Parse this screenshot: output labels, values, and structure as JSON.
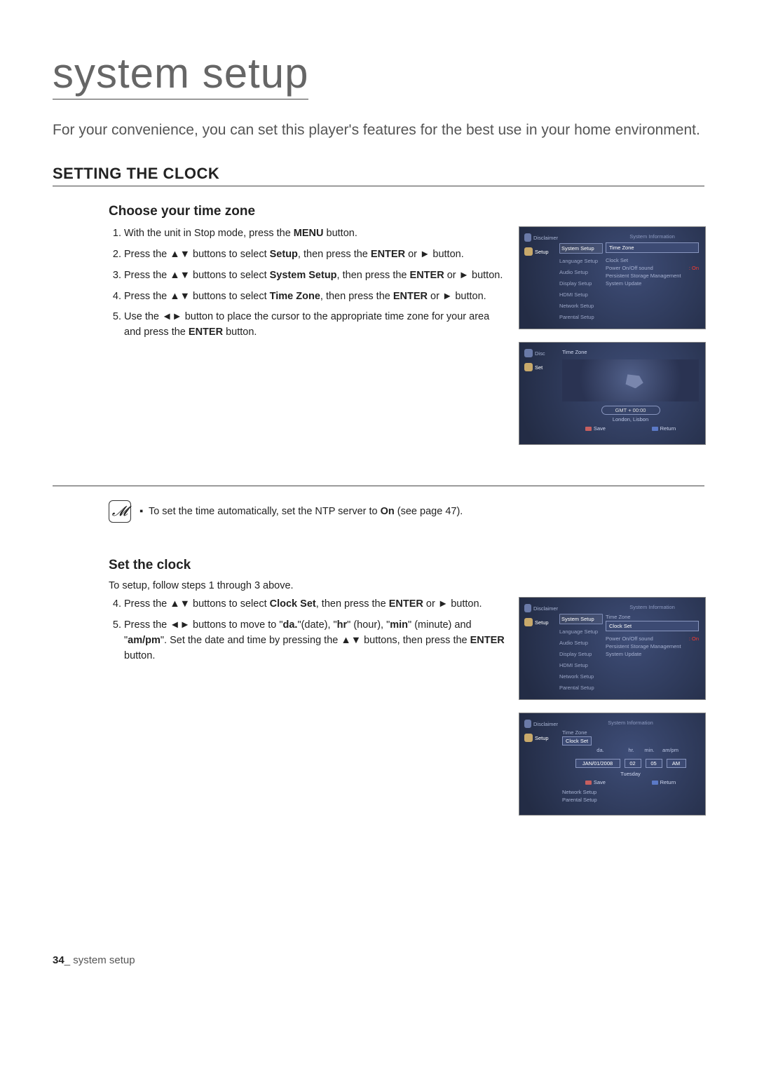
{
  "title": "system setup",
  "intro": "For your convenience, you can set this player's features for the best use in your home environment.",
  "section1_heading": "SETTING THE CLOCK",
  "sub1_heading": "Choose your time zone",
  "arrows_ud": "▲▼",
  "arrows_lr": "◄►",
  "arrow_r": "►",
  "steps1": {
    "s1_a": "With the unit in Stop mode, press the ",
    "s1_b": "MENU",
    "s1_c": " button.",
    "s2_a": "Press the ",
    "s2_b": " buttons to select ",
    "s2_c": "Setup",
    "s2_d": ", then press the ",
    "s2_e": "ENTER",
    "s2_f": " or ",
    "s2_g": " button.",
    "s3_a": "Press the ",
    "s3_b": " buttons to select ",
    "s3_c": "System Setup",
    "s3_d": ", then press the ",
    "s3_e": "ENTER",
    "s3_f": " or ",
    "s3_g": " button.",
    "s4_a": "Press the ",
    "s4_b": " buttons to select ",
    "s4_c": "Time Zone",
    "s4_d": ", then press the ",
    "s4_e": "ENTER",
    "s4_f": " or ",
    "s4_g": " button.",
    "s5_a": "Use the ",
    "s5_b": " button to place the cursor to the appropriate time zone for your area and press the ",
    "s5_c": "ENTER",
    "s5_d": " button."
  },
  "note_bullet": "▪",
  "note_a": "To set the time automatically, set the NTP server to ",
  "note_b": "On",
  "note_c": " (see page 47).",
  "sub2_heading": "Set the clock",
  "sub2_intro": "To setup, follow steps 1 through 3 above.",
  "steps2": {
    "s4_a": "Press the ",
    "s4_b": " buttons to select ",
    "s4_c": "Clock Set",
    "s4_d": ", then press the ",
    "s4_e": "ENTER",
    "s4_f": " or ",
    "s4_g": " button.",
    "s5_a": "Press the ",
    "s5_b": " buttons to move to \"",
    "s5_c": "da.",
    "s5_d": "\"(date), \"",
    "s5_e": "hr",
    "s5_f": "\" (hour), \"",
    "s5_g": "min",
    "s5_h": "\" (minute) and \"",
    "s5_i": "am/pm",
    "s5_j": "\". Set the date and time by pressing the ",
    "s5_k": " buttons, then press the ",
    "s5_l": "ENTER",
    "s5_m": " button."
  },
  "ss_common": {
    "disclaimer": "Disclaimer",
    "setup": "Setup",
    "sysinfo": "System Information",
    "menu": {
      "system": "System Setup",
      "language": "Language Setup",
      "audio": "Audio Setup",
      "display": "Display Setup",
      "hdmi": "HDMI Setup",
      "network": "Network Setup",
      "parental": "Parental Setup"
    },
    "options": {
      "timezone": "Time Zone",
      "clockset": "Clock Set",
      "power": "Power On/Off sound",
      "on": ": On",
      "psm": "Persistent Storage Management",
      "update": "System Update"
    },
    "save": "Save",
    "return": "Return"
  },
  "ss_tz": {
    "title": "Time Zone",
    "gmt": "GMT + 00:00",
    "city": "London, Lisbon",
    "disc_short": "Disc",
    "set_short": "Set"
  },
  "ss_clock": {
    "label": "Clock Set",
    "da": "da.",
    "hr": "hr.",
    "min": "min.",
    "ampm": "am/pm",
    "date": "JAN/01/2008",
    "h": "02",
    "m": "05",
    "ap": "AM",
    "day": "Tuesday"
  },
  "footer_page": "34",
  "footer_sep": "_ ",
  "footer_text": "system setup"
}
